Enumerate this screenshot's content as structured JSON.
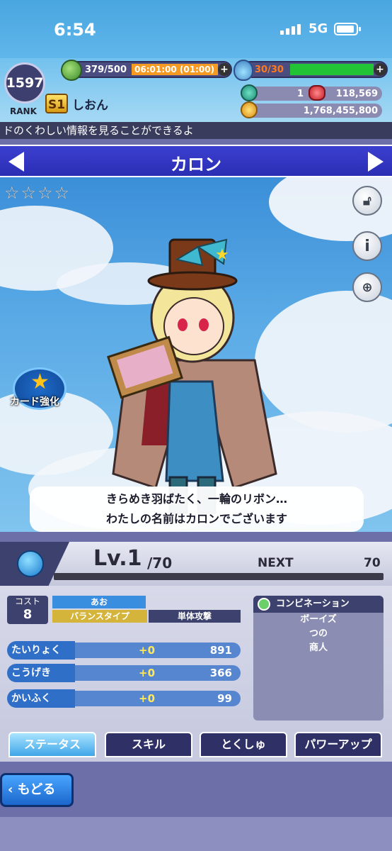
{
  "status_bar": {
    "time": "6:54",
    "network": "5G"
  },
  "header": {
    "rank_value": "1597",
    "rank_label": "RANK",
    "stamina": "379/500",
    "stamina_timer": "06:01:00 (01:00)",
    "potion": "30/30",
    "rank_badge": "S1",
    "player_name": "しおん",
    "gem_count": "1",
    "ruby_count": "118,569",
    "coin_count": "1,768,455,800",
    "plus_icon": "plus-icon"
  },
  "ticker": "ドのくわしい情報を見ることができるよ",
  "card": {
    "name": "カロン",
    "stars": [
      "☆",
      "☆",
      "☆",
      "☆"
    ],
    "quote_line1": "きらめき羽ばたく、一輪のリボン…",
    "quote_line2": "わたしの名前はカロンでございます",
    "enhance_label": "カード強化"
  },
  "level": {
    "lv_text": "Lv.1",
    "lv_max": "/70",
    "next_label": "NEXT",
    "next_value": "70"
  },
  "stats": {
    "cost_label": "コスト",
    "cost_value": "8",
    "color": "あお",
    "type": "バランスタイプ",
    "attack": "単体攻撃",
    "rows": [
      {
        "label": "たいりょく",
        "plus": "+0",
        "value": "891"
      },
      {
        "label": "こうげき",
        "plus": "+0",
        "value": "366"
      },
      {
        "label": "かいふく",
        "plus": "+0",
        "value": "99"
      }
    ],
    "combo_title": "コンビネーション",
    "combo_items": [
      "ボーイズ",
      "つの",
      "商人"
    ]
  },
  "tabs": [
    "ステータス",
    "スキル",
    "とくしゅ",
    "パワーアップ"
  ],
  "back_label": "もどる",
  "colors": {
    "title_band": "#2a2eb4",
    "sky": "#5aaae6",
    "stat_bar": "#5686cf"
  }
}
